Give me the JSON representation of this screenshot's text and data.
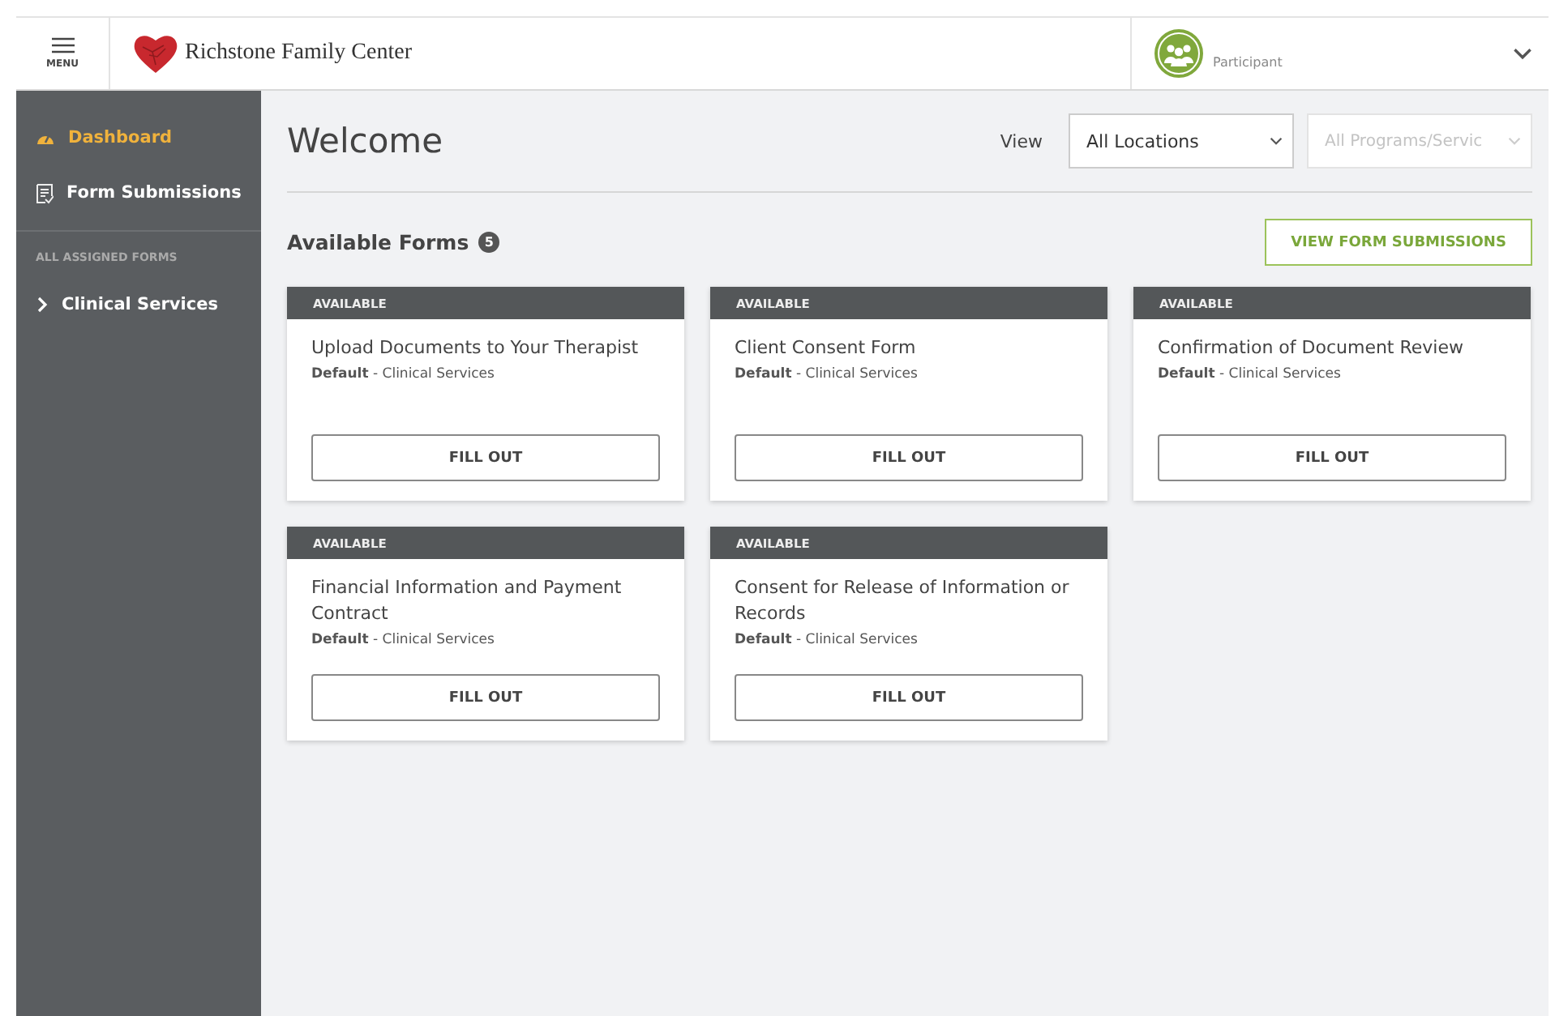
{
  "header": {
    "menu_label": "MENU",
    "brand": "Richstone Family Center",
    "user_role": "Participant"
  },
  "sidebar": {
    "items": [
      {
        "label": "Dashboard",
        "selected": true,
        "kind": "dashboard"
      },
      {
        "label": "Form Submissions",
        "selected": false,
        "kind": "submissions"
      }
    ],
    "section_title": "ALL ASSIGNED FORMS",
    "groups": [
      {
        "label": "Clinical Services",
        "expanded": false
      }
    ]
  },
  "main": {
    "title": "Welcome",
    "view_label": "View",
    "filters": [
      {
        "value": "All Locations",
        "disabled": false
      },
      {
        "value": "All Programs/Servic",
        "disabled": true
      }
    ],
    "section_title": "Available Forms",
    "count": "5",
    "view_button": "VIEW FORM SUBMISSIONS",
    "forms": [
      {
        "status": "AVAILABLE",
        "title": "Upload Documents to Your Therapist",
        "subtitle": "**Default** - Clinical Services",
        "button": "FILL OUT"
      },
      {
        "status": "AVAILABLE",
        "title": "Client Consent Form",
        "subtitle": "**Default** - Clinical Services",
        "button": "FILL OUT"
      },
      {
        "status": "AVAILABLE",
        "title": "Confirmation of Document Review",
        "subtitle": "**Default** - Clinical Services",
        "button": "FILL OUT"
      },
      {
        "status": "AVAILABLE",
        "title": "Financial Information and Payment Contract",
        "subtitle": "**Default** - Clinical Services",
        "button": "FILL OUT"
      },
      {
        "status": "AVAILABLE",
        "title": "Consent for Release of Information or Records",
        "subtitle": "**Default** - Clinical Services",
        "button": "FILL OUT"
      }
    ]
  }
}
